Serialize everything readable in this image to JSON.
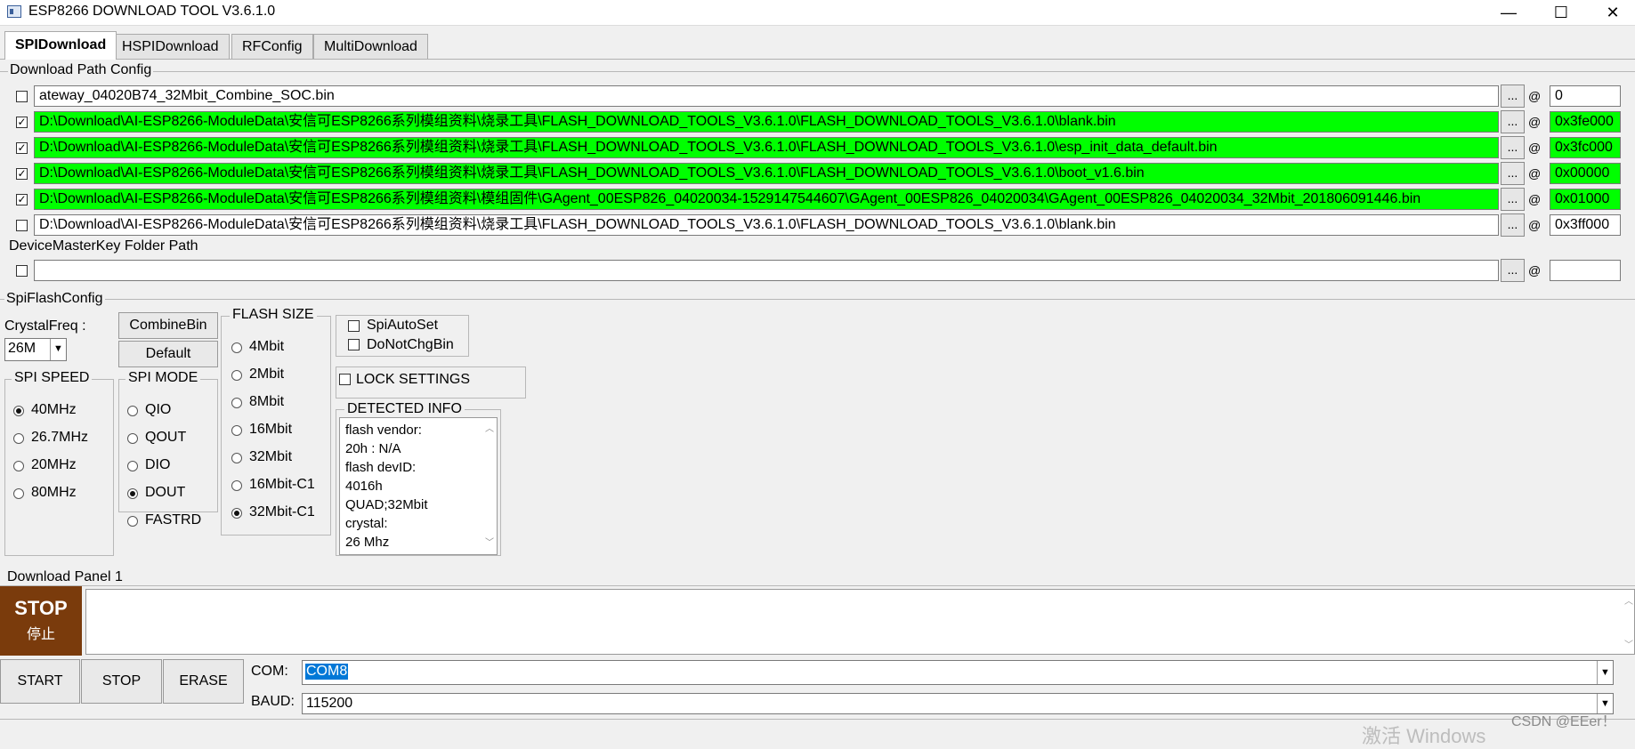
{
  "window": {
    "title": "ESP8266 DOWNLOAD TOOL V3.6.1.0",
    "minimize": "—",
    "maximize": "☐",
    "close": "✕"
  },
  "tabs": [
    {
      "label": "SPIDownload",
      "active": true
    },
    {
      "label": "HSPIDownload",
      "active": false
    },
    {
      "label": "RFConfig",
      "active": false
    },
    {
      "label": "MultiDownload",
      "active": false
    }
  ],
  "download_path": {
    "title": "Download Path Config",
    "rows": [
      {
        "checked": false,
        "path": "ateway_04020B74_32Mbit_Combine_SOC.bin",
        "addr": "0",
        "highlight": false
      },
      {
        "checked": true,
        "path": "D:\\Download\\AI-ESP8266-ModuleData\\安信可ESP8266系列模组资料\\烧录工具\\FLASH_DOWNLOAD_TOOLS_V3.6.1.0\\FLASH_DOWNLOAD_TOOLS_V3.6.1.0\\blank.bin",
        "addr": "0x3fe000",
        "highlight": true
      },
      {
        "checked": true,
        "path": "D:\\Download\\AI-ESP8266-ModuleData\\安信可ESP8266系列模组资料\\烧录工具\\FLASH_DOWNLOAD_TOOLS_V3.6.1.0\\FLASH_DOWNLOAD_TOOLS_V3.6.1.0\\esp_init_data_default.bin",
        "addr": "0x3fc000",
        "highlight": true
      },
      {
        "checked": true,
        "path": "D:\\Download\\AI-ESP8266-ModuleData\\安信可ESP8266系列模组资料\\烧录工具\\FLASH_DOWNLOAD_TOOLS_V3.6.1.0\\FLASH_DOWNLOAD_TOOLS_V3.6.1.0\\boot_v1.6.bin",
        "addr": "0x00000",
        "highlight": true
      },
      {
        "checked": true,
        "path": "D:\\Download\\AI-ESP8266-ModuleData\\安信可ESP8266系列模组资料\\模组固件\\GAgent_00ESP826_04020034-1529147544607\\GAgent_00ESP826_04020034\\GAgent_00ESP826_04020034_32Mbit_201806091446.bin",
        "addr": "0x01000",
        "highlight": true
      },
      {
        "checked": false,
        "path": "D:\\Download\\AI-ESP8266-ModuleData\\安信可ESP8266系列模组资料\\烧录工具\\FLASH_DOWNLOAD_TOOLS_V3.6.1.0\\FLASH_DOWNLOAD_TOOLS_V3.6.1.0\\blank.bin",
        "addr": "0x3ff000",
        "highlight": false
      }
    ],
    "browse_label": "...",
    "at_label": "@",
    "devicekey_label": "DeviceMasterKey Folder Path",
    "devicekey_path": "",
    "devicekey_addr": ""
  },
  "spiflash": {
    "title": "SpiFlashConfig",
    "crystal_label": "CrystalFreq :",
    "crystal_value": "26M",
    "combine_btn": "CombineBin",
    "default_btn": "Default",
    "speed_title": "SPI SPEED",
    "speed_options": [
      {
        "label": "40MHz",
        "selected": true
      },
      {
        "label": "26.7MHz",
        "selected": false
      },
      {
        "label": "20MHz",
        "selected": false
      },
      {
        "label": "80MHz",
        "selected": false
      }
    ],
    "mode_title": "SPI MODE",
    "mode_options": [
      {
        "label": "QIO",
        "selected": false
      },
      {
        "label": "QOUT",
        "selected": false
      },
      {
        "label": "DIO",
        "selected": false
      },
      {
        "label": "DOUT",
        "selected": true
      },
      {
        "label": "FASTRD",
        "selected": false
      }
    ],
    "size_title": "FLASH SIZE",
    "size_options": [
      {
        "label": "4Mbit",
        "selected": false
      },
      {
        "label": "2Mbit",
        "selected": false
      },
      {
        "label": "8Mbit",
        "selected": false
      },
      {
        "label": "16Mbit",
        "selected": false
      },
      {
        "label": "32Mbit",
        "selected": false
      },
      {
        "label": "16Mbit-C1",
        "selected": false
      },
      {
        "label": "32Mbit-C1",
        "selected": true
      }
    ],
    "spiautoset": "SpiAutoSet",
    "donotchgbin": "DoNotChgBin",
    "lock": "LOCK SETTINGS",
    "detected_title": "DETECTED INFO",
    "detected_lines": [
      "flash vendor:",
      "20h : N/A",
      "flash devID:",
      "4016h",
      "QUAD;32Mbit",
      "crystal:",
      "26 Mhz"
    ]
  },
  "download_panel": {
    "title": "Download Panel 1",
    "stop_big": "STOP",
    "stop_big_cn": "停止",
    "start_btn": "START",
    "stop_btn": "STOP",
    "erase_btn": "ERASE",
    "com_label": "COM:",
    "com_value": "COM8",
    "baud_label": "BAUD:",
    "baud_value": "115200"
  },
  "overlay": {
    "watermark": "激活 Windows",
    "csdn": "CSDN @EEer！"
  },
  "colors": {
    "highlight_green": "#00ff00",
    "stop_brown": "#7a3b0c",
    "selected_blue": "#0078d7"
  }
}
